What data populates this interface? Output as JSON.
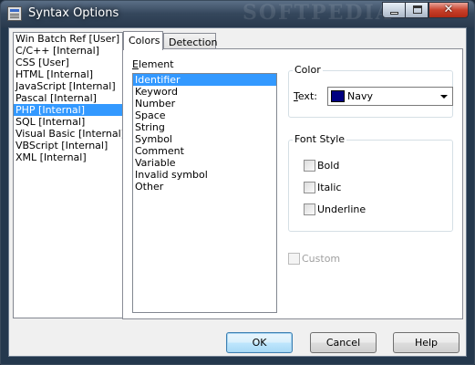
{
  "window": {
    "title": "Syntax Options",
    "watermark": "SOFTPEDIA",
    "close_glyph": "✕"
  },
  "languages": [
    {
      "label": "Win Batch Ref [User]",
      "selected": false
    },
    {
      "label": "C/C++ [Internal]",
      "selected": false
    },
    {
      "label": "CSS [User]",
      "selected": false
    },
    {
      "label": "HTML [Internal]",
      "selected": false
    },
    {
      "label": "JavaScript [Internal]",
      "selected": false
    },
    {
      "label": "Pascal [Internal]",
      "selected": false
    },
    {
      "label": "PHP [Internal]",
      "selected": true
    },
    {
      "label": "SQL [Internal]",
      "selected": false
    },
    {
      "label": "Visual Basic [Internal]",
      "selected": false
    },
    {
      "label": "VBScript [Internal]",
      "selected": false
    },
    {
      "label": "XML [Internal]",
      "selected": false
    }
  ],
  "tabs": [
    {
      "label": "Colors",
      "active": true
    },
    {
      "label": "Detection",
      "active": false
    }
  ],
  "element": {
    "label_u": "E",
    "label_rest": "lement",
    "items": [
      {
        "label": "Identifier",
        "selected": true
      },
      {
        "label": "Keyword",
        "selected": false
      },
      {
        "label": "Number",
        "selected": false
      },
      {
        "label": "Space",
        "selected": false
      },
      {
        "label": "String",
        "selected": false
      },
      {
        "label": "Symbol",
        "selected": false
      },
      {
        "label": "Comment",
        "selected": false
      },
      {
        "label": "Variable",
        "selected": false
      },
      {
        "label": "Invalid symbol",
        "selected": false
      },
      {
        "label": "Other",
        "selected": false
      }
    ]
  },
  "color_group": {
    "title": "Color",
    "text_label_u": "T",
    "text_label_rest": "ext:",
    "selected_value": "Navy",
    "swatch_color": "#000080"
  },
  "font_style_group": {
    "title": "Font Style",
    "bold": "Bold",
    "italic": "Italic",
    "underline": "Underline"
  },
  "custom_label": "Custom",
  "buttons": {
    "ok": "OK",
    "cancel": "Cancel",
    "help": "Help"
  }
}
